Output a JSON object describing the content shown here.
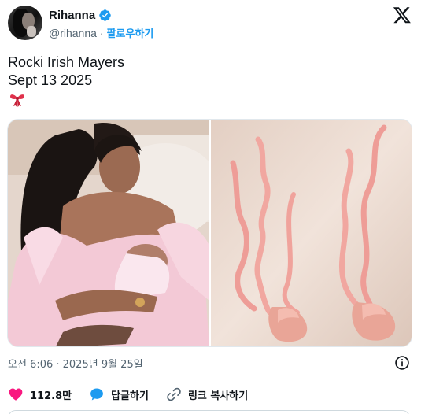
{
  "author": {
    "name": "Rihanna",
    "handle": "@rihanna",
    "separator": "·",
    "follow_label": "팔로우하기",
    "verified_color": "#1d9bf0",
    "avatar_icon": "avatar-photo"
  },
  "tweet": {
    "lines": [
      "Rocki Irish Mayers",
      "Sept 13 2025"
    ],
    "emoji": "ribbon-bow",
    "media": [
      {
        "kind": "photo",
        "description_icon": "photo-left"
      },
      {
        "kind": "photo",
        "description_icon": "photo-right"
      }
    ]
  },
  "meta": {
    "timestamp": "오전 6:06 · 2025년 9월 25일"
  },
  "actions": {
    "like_count": "112.8만",
    "reply_label": "답글하기",
    "copy_link_label": "링크 복사하기",
    "like_color": "#f91880",
    "reply_color": "#1d9bf0"
  },
  "brand": {
    "logo": "x-logo",
    "color": "#0f1419"
  }
}
